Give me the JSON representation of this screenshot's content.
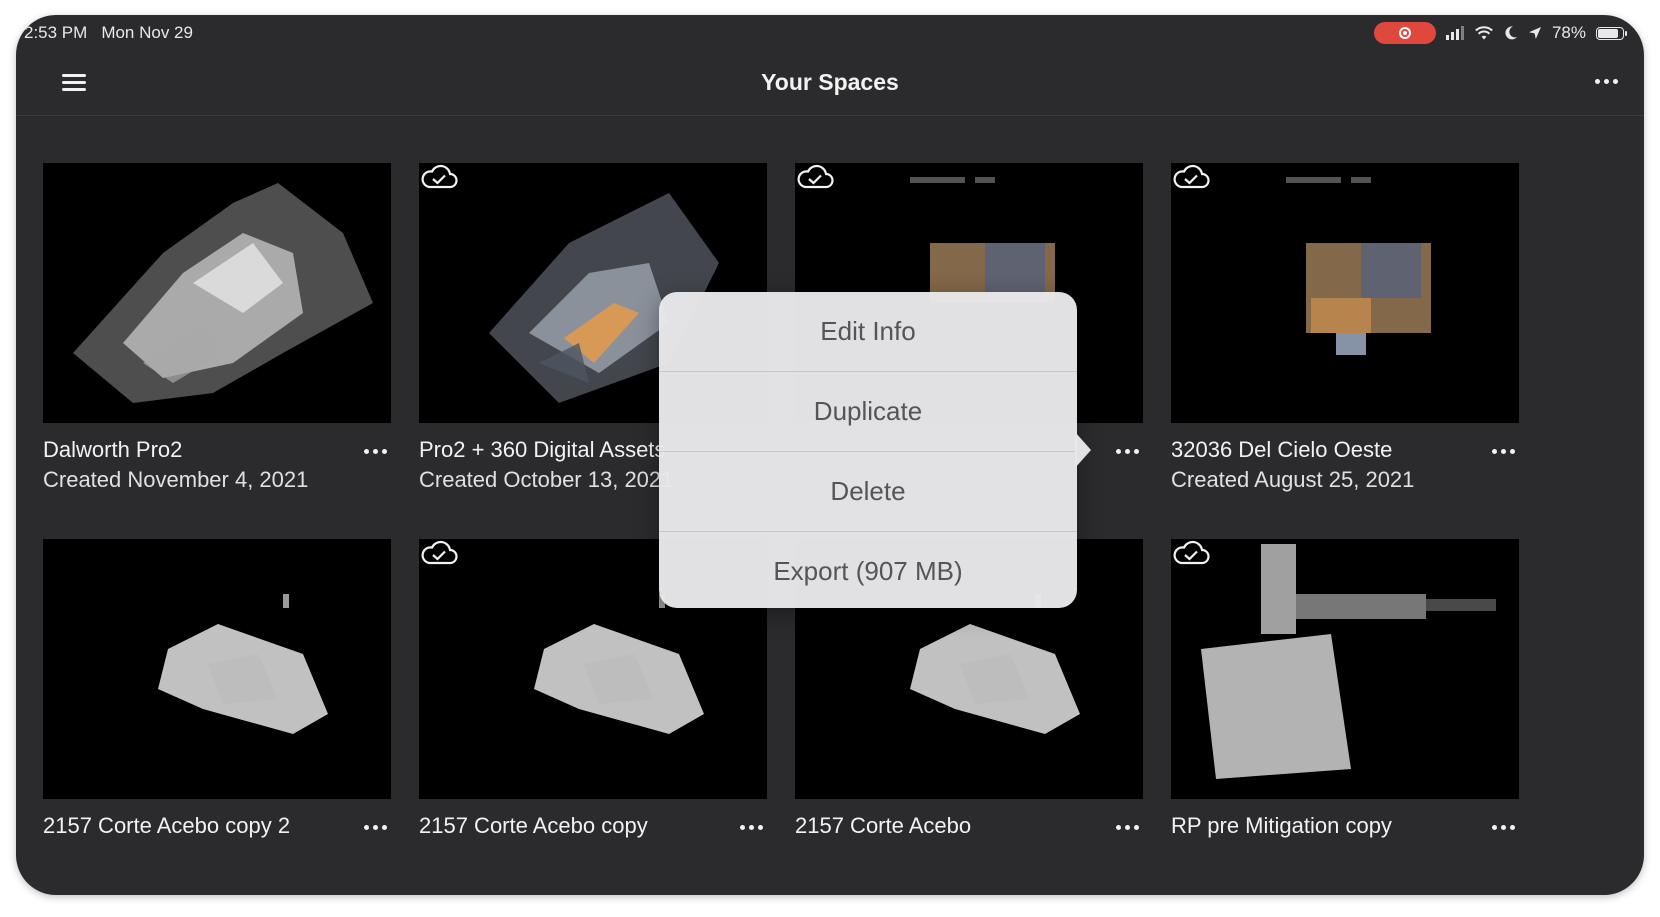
{
  "status_bar": {
    "time": "2:53 PM",
    "date": "Mon Nov 29",
    "battery": "78%"
  },
  "nav": {
    "title": "Your Spaces"
  },
  "spaces": [
    {
      "title": "Dalworth Pro2",
      "subtitle": "Created November 4, 2021",
      "synced": false
    },
    {
      "title": "Pro2 + 360 Digital Assets",
      "subtitle": "Created October 13, 2021",
      "synced": true
    },
    {
      "title": "",
      "subtitle": "",
      "synced": true
    },
    {
      "title": "32036 Del Cielo Oeste",
      "subtitle": "Created August 25, 2021",
      "synced": true
    },
    {
      "title": "2157 Corte Acebo copy 2",
      "subtitle": "",
      "synced": false
    },
    {
      "title": "2157 Corte Acebo copy",
      "subtitle": "",
      "synced": true
    },
    {
      "title": "2157 Corte Acebo",
      "subtitle": "",
      "synced": false
    },
    {
      "title": "RP pre Mitigation copy",
      "subtitle": "",
      "synced": true
    }
  ],
  "context_menu": {
    "items": [
      "Edit Info",
      "Duplicate",
      "Delete",
      "Export (907 MB)"
    ]
  },
  "colors": {
    "background": "#2b2b2d",
    "thumbnail": "#000000",
    "record": "#e0483e",
    "menu": "#e8e8ea"
  },
  "icons": {
    "menu": "hamburger-icon",
    "more": "ellipsis-icon",
    "cloud": "cloud-check-icon"
  }
}
